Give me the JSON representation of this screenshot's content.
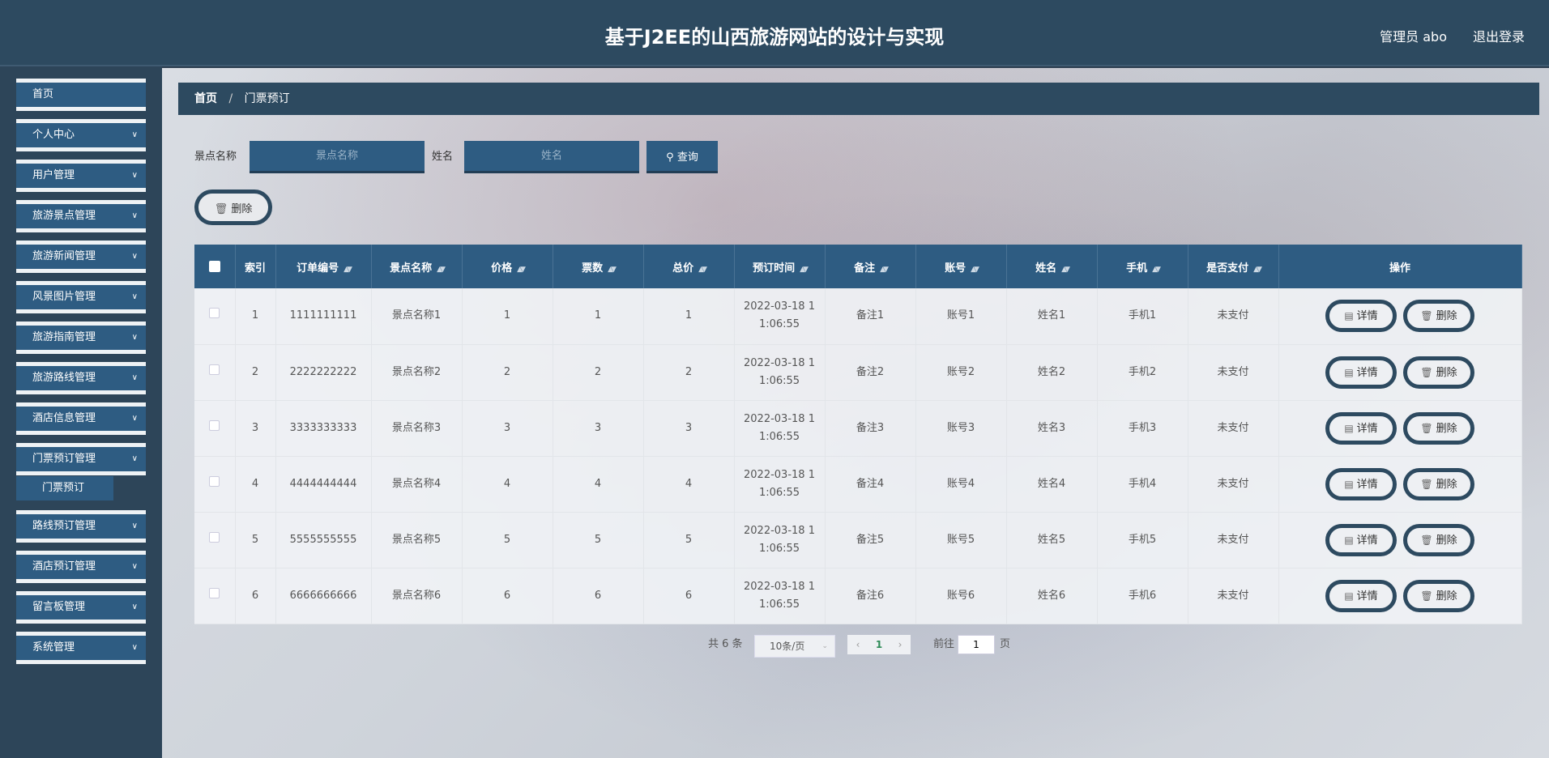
{
  "header": {
    "title": "基于J2EE的山西旅游网站的设计与实现",
    "user": "管理员 abo",
    "logout": "退出登录"
  },
  "sidebar": {
    "items": [
      {
        "label": "首页",
        "has_children": false
      },
      {
        "label": "个人中心",
        "has_children": true
      },
      {
        "label": "用户管理",
        "has_children": true
      },
      {
        "label": "旅游景点管理",
        "has_children": true
      },
      {
        "label": "旅游新闻管理",
        "has_children": true
      },
      {
        "label": "风景图片管理",
        "has_children": true
      },
      {
        "label": "旅游指南管理",
        "has_children": true
      },
      {
        "label": "旅游路线管理",
        "has_children": true
      },
      {
        "label": "酒店信息管理",
        "has_children": true
      },
      {
        "label": "门票预订管理",
        "has_children": true
      },
      {
        "label": "路线预订管理",
        "has_children": true
      },
      {
        "label": "酒店预订管理",
        "has_children": true
      },
      {
        "label": "留言板管理",
        "has_children": true
      },
      {
        "label": "系统管理",
        "has_children": true
      }
    ],
    "submenu": {
      "label": "门票预订"
    }
  },
  "breadcrumb": {
    "home": "首页",
    "sep": "/",
    "current": "门票预订"
  },
  "search": {
    "spot_label": "景点名称",
    "spot_placeholder": "景点名称",
    "name_label": "姓名",
    "name_placeholder": "姓名",
    "query_label": "查询"
  },
  "actions": {
    "delete_label": "删除"
  },
  "table": {
    "headers": [
      "索引",
      "订单编号",
      "景点名称",
      "价格",
      "票数",
      "总价",
      "预订时间",
      "备注",
      "账号",
      "姓名",
      "手机",
      "是否支付",
      "操作"
    ],
    "rows": [
      {
        "idx": "1",
        "order": "1111111111",
        "spot": "景点名称1",
        "price": "1",
        "count": "1",
        "total": "1",
        "time1": "2022-03-18 1",
        "time2": "1:06:55",
        "note": "备注1",
        "account": "账号1",
        "name": "姓名1",
        "phone": "手机1",
        "paid": "未支付"
      },
      {
        "idx": "2",
        "order": "2222222222",
        "spot": "景点名称2",
        "price": "2",
        "count": "2",
        "total": "2",
        "time1": "2022-03-18 1",
        "time2": "1:06:55",
        "note": "备注2",
        "account": "账号2",
        "name": "姓名2",
        "phone": "手机2",
        "paid": "未支付"
      },
      {
        "idx": "3",
        "order": "3333333333",
        "spot": "景点名称3",
        "price": "3",
        "count": "3",
        "total": "3",
        "time1": "2022-03-18 1",
        "time2": "1:06:55",
        "note": "备注3",
        "account": "账号3",
        "name": "姓名3",
        "phone": "手机3",
        "paid": "未支付"
      },
      {
        "idx": "4",
        "order": "4444444444",
        "spot": "景点名称4",
        "price": "4",
        "count": "4",
        "total": "4",
        "time1": "2022-03-18 1",
        "time2": "1:06:55",
        "note": "备注4",
        "account": "账号4",
        "name": "姓名4",
        "phone": "手机4",
        "paid": "未支付"
      },
      {
        "idx": "5",
        "order": "5555555555",
        "spot": "景点名称5",
        "price": "5",
        "count": "5",
        "total": "5",
        "time1": "2022-03-18 1",
        "time2": "1:06:55",
        "note": "备注5",
        "account": "账号5",
        "name": "姓名5",
        "phone": "手机5",
        "paid": "未支付"
      },
      {
        "idx": "6",
        "order": "6666666666",
        "spot": "景点名称6",
        "price": "6",
        "count": "6",
        "total": "6",
        "time1": "2022-03-18 1",
        "time2": "1:06:55",
        "note": "备注6",
        "account": "账号6",
        "name": "姓名6",
        "phone": "手机6",
        "paid": "未支付"
      }
    ],
    "detail_label": "详情",
    "delete_label": "删除"
  },
  "pagination": {
    "total": "共 6 条",
    "page_size": "10条/页",
    "current_page": "1",
    "goto_label": "前往",
    "goto_value": "1",
    "page_suffix": "页"
  },
  "icons": {
    "chevron": "chevron-down-icon",
    "search": "search-icon",
    "trash": "trash-icon",
    "detail": "document-icon",
    "sort": "sort-icon"
  },
  "colors": {
    "header_bg": "#2d4a60",
    "menu_bg": "#2e5c82",
    "table_header": "#2e5c82",
    "current_page": "#2e8b57"
  }
}
